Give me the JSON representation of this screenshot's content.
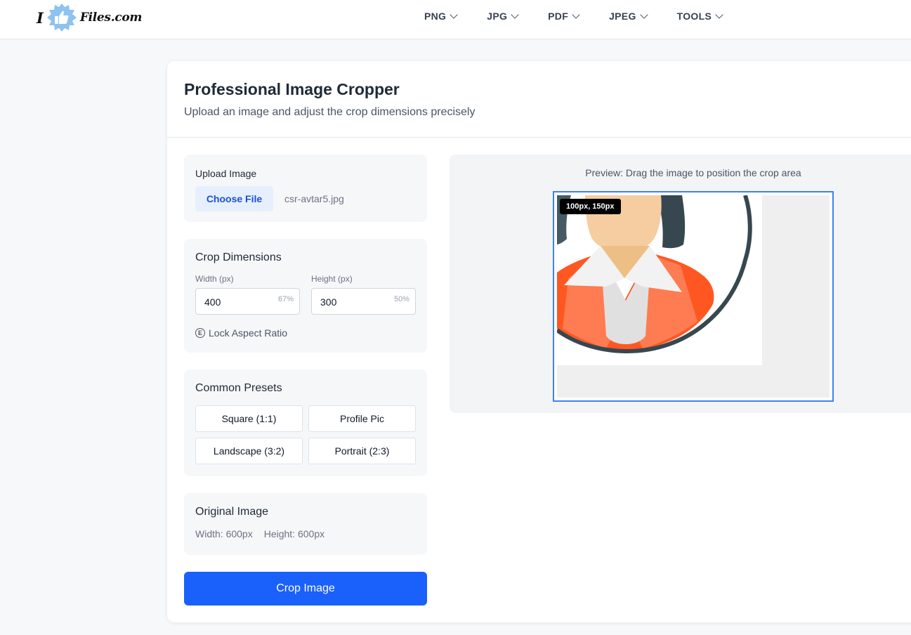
{
  "logo": {
    "prefix": "I",
    "text": "Files.com"
  },
  "nav": [
    {
      "label": "PNG"
    },
    {
      "label": "JPG"
    },
    {
      "label": "PDF"
    },
    {
      "label": "JPEG"
    },
    {
      "label": "TOOLS"
    }
  ],
  "card": {
    "title": "Professional Image Cropper",
    "subtitle": "Upload an image and adjust the crop dimensions precisely"
  },
  "upload": {
    "label": "Upload Image",
    "button_label": "Choose File",
    "file_name": "csr-avtar5.jpg"
  },
  "dimensions": {
    "title": "Crop Dimensions",
    "width": {
      "label": "Width (px)",
      "value": "400",
      "percent": "67%"
    },
    "height": {
      "label": "Height (px)",
      "value": "300",
      "percent": "50%"
    },
    "lock_label": "Lock Aspect Ratio",
    "lock_glyph": "E"
  },
  "presets": {
    "title": "Common Presets",
    "items": [
      {
        "label": "Square (1:1)"
      },
      {
        "label": "Profile Pic"
      },
      {
        "label": "Landscape (3:2)"
      },
      {
        "label": "Portrait (2:3)"
      }
    ]
  },
  "original": {
    "title": "Original Image",
    "width_text": "Width: 600px",
    "height_text": "Height: 600px"
  },
  "crop_button": "Crop Image",
  "preview": {
    "instruction": "Preview: Drag the image to position the crop area",
    "position_badge": "100px, 150px"
  },
  "colors": {
    "accent": "#1a60fb",
    "crop_border": "#3b82f6",
    "logo_blue": "#8ec3f0",
    "jacket": "#ff5722",
    "hair": "#37474f",
    "skin": "#f5cda0"
  }
}
